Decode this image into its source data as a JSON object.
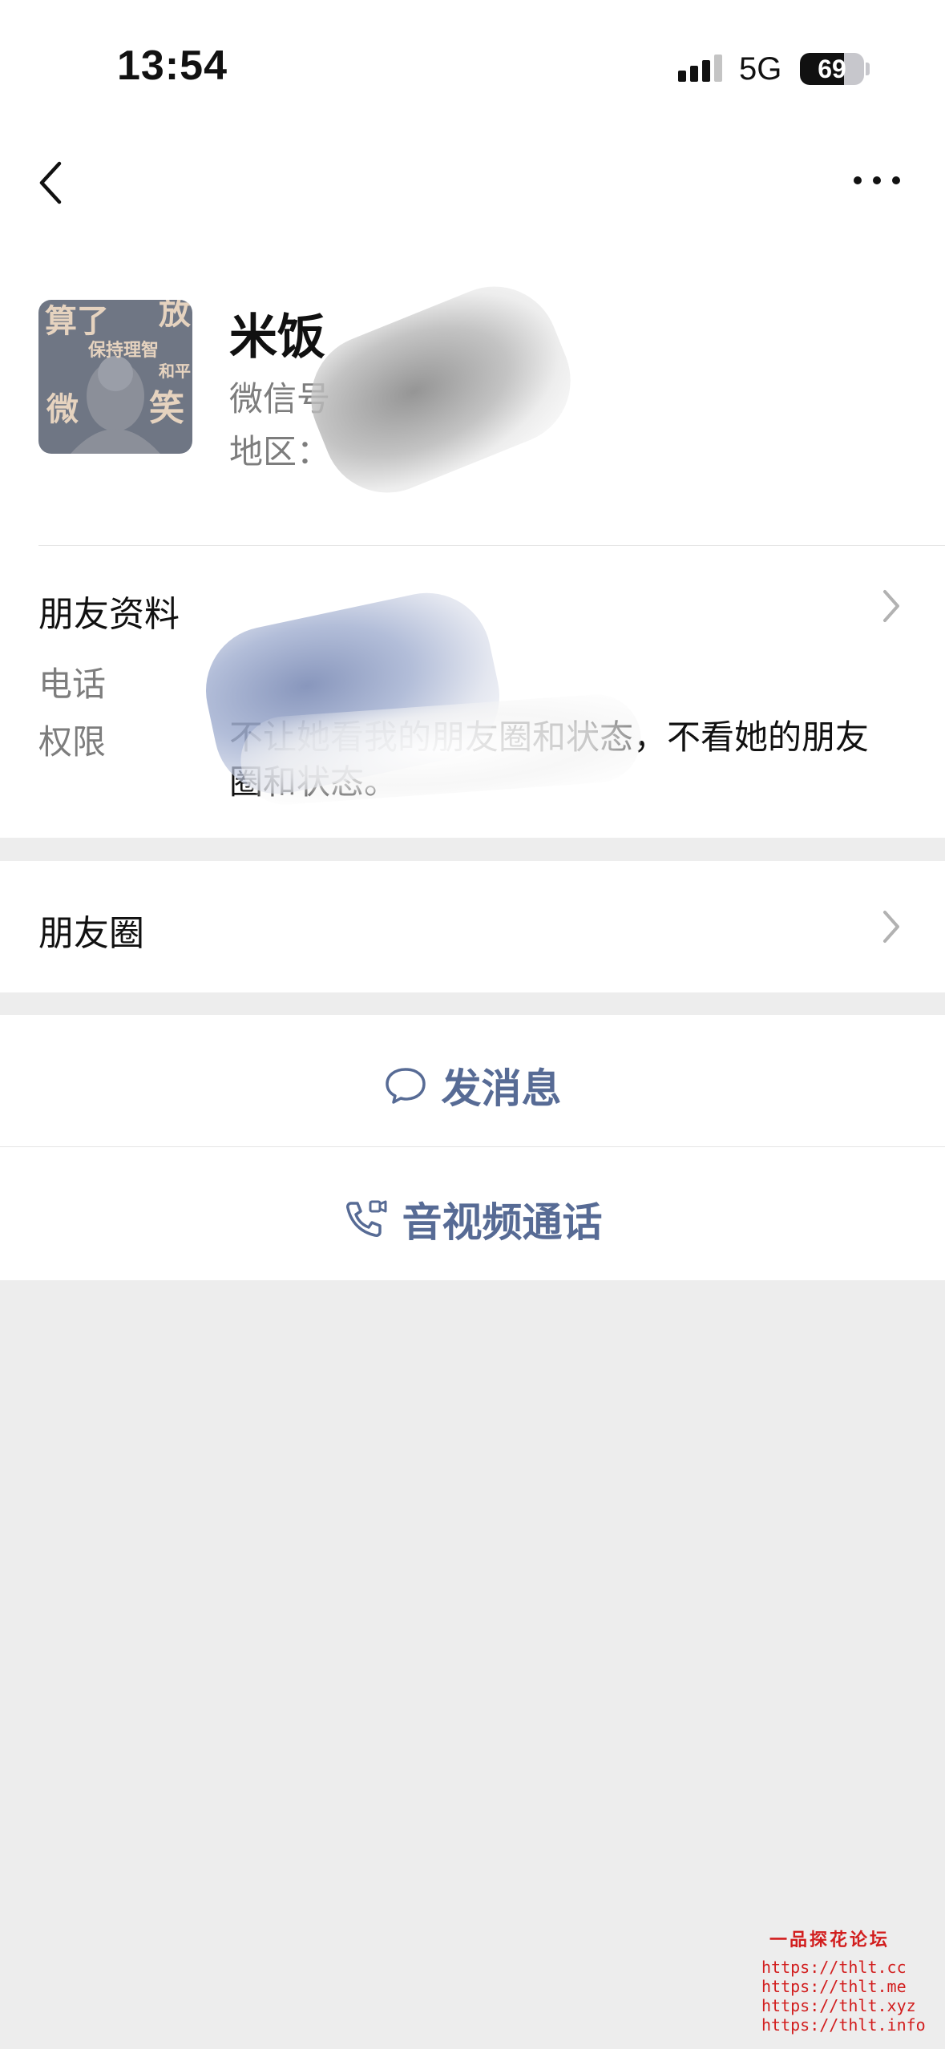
{
  "status_bar": {
    "time": "13:54",
    "network": "5G",
    "battery": "69",
    "battery_level": 0.69
  },
  "nav": {
    "back_icon": "chevron-left-icon",
    "more_icon": "more-dots-icon"
  },
  "profile": {
    "name": "米饭",
    "wechat_id_label": "微信号",
    "region_label": "地区：",
    "avatar_text": [
      "放",
      "算了",
      "微",
      "笑",
      "保持理智",
      "和平"
    ]
  },
  "friend_info": {
    "title": "朋友资料",
    "phone_label": "电话",
    "permission_label": "权限",
    "permission_text": "不让她看我的朋友圈和状态，不看她的朋友圈和状态。"
  },
  "moments": {
    "title": "朋友圈"
  },
  "actions": {
    "message": "发消息",
    "call": "音视频通话"
  },
  "watermark": {
    "title": "一品探花论坛",
    "links": [
      "https://thlt.cc",
      "https://thlt.me",
      "https://thlt.xyz",
      "https://thlt.info"
    ]
  },
  "colors": {
    "accent": "#576b95",
    "background": "#ededed",
    "watermark": "#d21e1e"
  }
}
